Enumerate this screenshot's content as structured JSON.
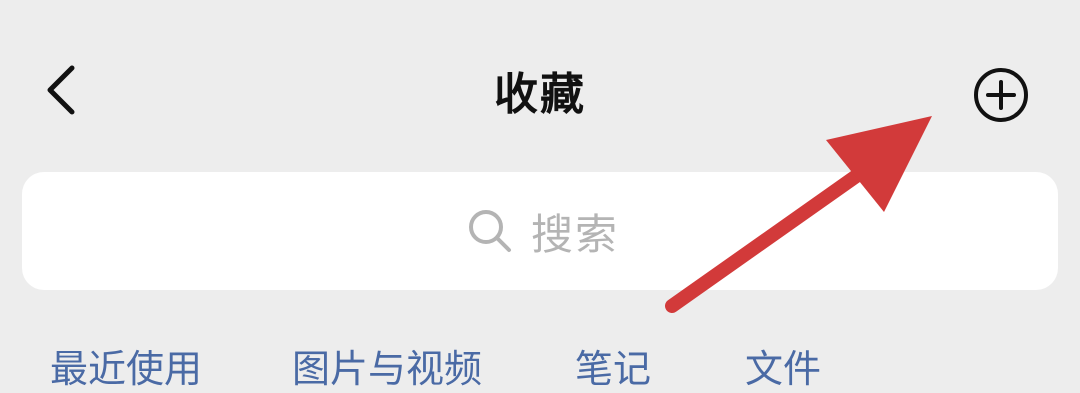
{
  "header": {
    "title": "收藏",
    "back_icon": "chevron-left-icon",
    "add_icon": "plus-circle-icon"
  },
  "search": {
    "placeholder": "搜索",
    "icon": "search-icon"
  },
  "tabs": [
    {
      "label": "最近使用"
    },
    {
      "label": "图片与视频"
    },
    {
      "label": "笔记"
    },
    {
      "label": "文件"
    }
  ],
  "annotation": {
    "arrow_color": "#d23a3a"
  },
  "colors": {
    "background": "#ededed",
    "tab_text": "#4a6aa5",
    "placeholder": "#b4b4b4"
  }
}
